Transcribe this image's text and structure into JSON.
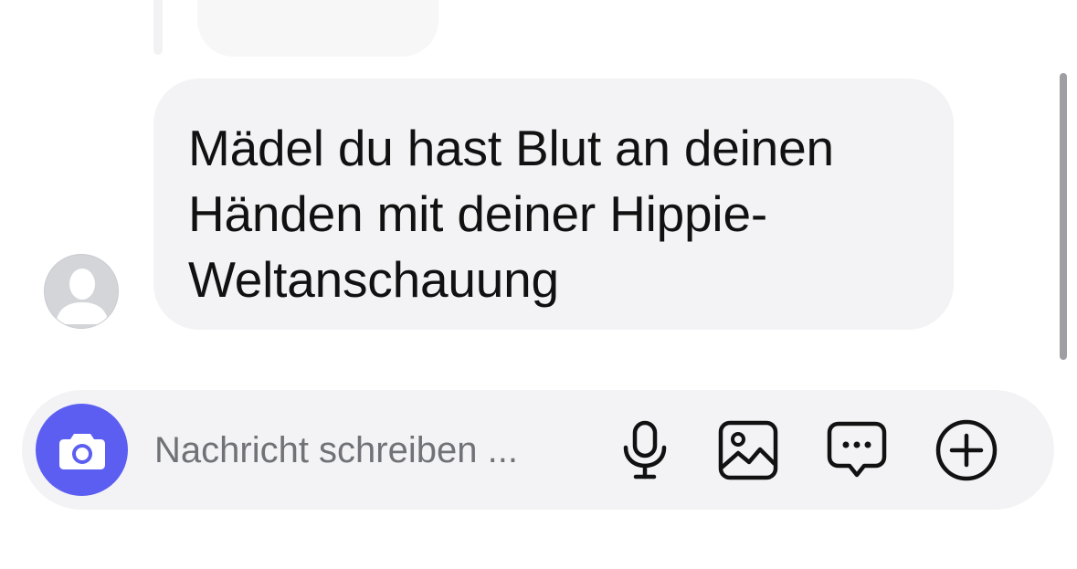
{
  "message": {
    "lines": [
      "Mädel du hast Blut an deinen",
      "Händen mit deiner Hippie-",
      "Weltanschauung"
    ]
  },
  "composer": {
    "placeholder": "Nachricht schreiben ...",
    "value": "",
    "accent_color": "#5b5ef1",
    "icons": [
      "camera-icon",
      "microphone-icon",
      "image-icon",
      "chat-bubble-icon",
      "plus-circle-icon"
    ]
  }
}
